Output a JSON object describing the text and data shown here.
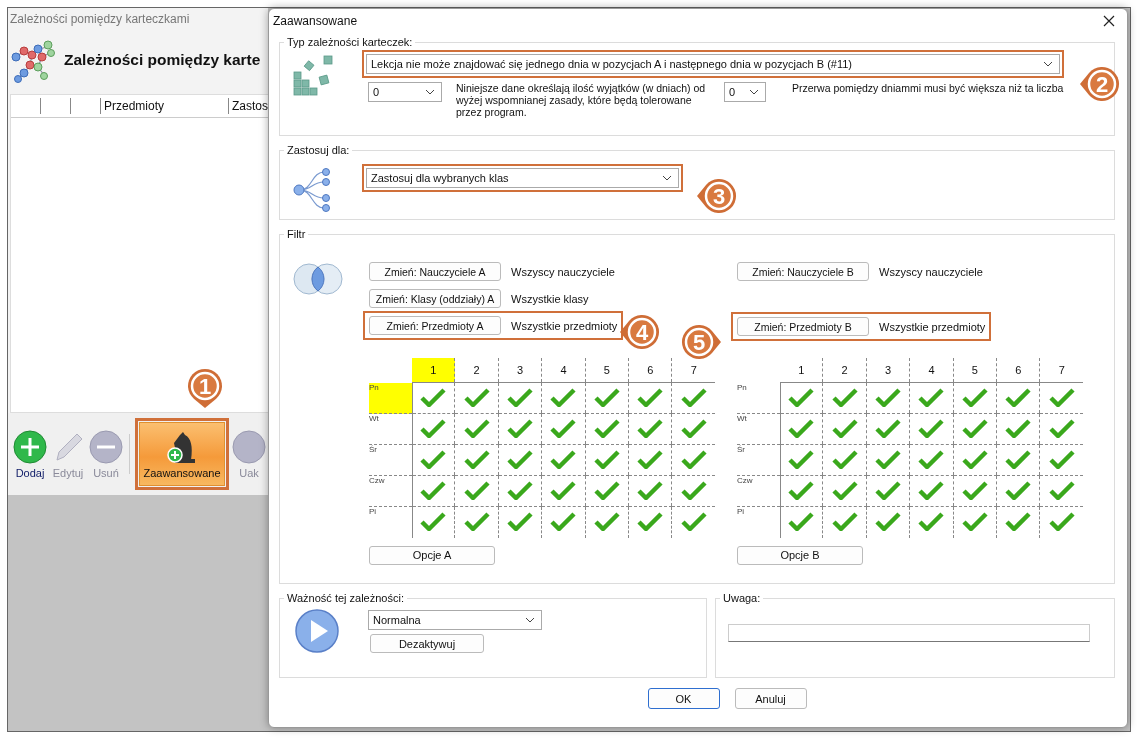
{
  "back_window": {
    "title": "Zależności pomiędzy karteczkami",
    "heading": "Zależności pomiędzy karte",
    "columns": [
      {
        "label": "Przedmioty"
      },
      {
        "label": "Zastos"
      }
    ],
    "toolbar": [
      {
        "label": "Dodaj",
        "kind": "add",
        "disabled": false,
        "highlighted": false
      },
      {
        "label": "Edytuj",
        "kind": "edit",
        "disabled": true,
        "highlighted": false
      },
      {
        "label": "Usuń",
        "kind": "remove",
        "disabled": true,
        "highlighted": false
      },
      {
        "label": "Zaawansowane",
        "kind": "advanced",
        "disabled": false,
        "highlighted": true
      },
      {
        "label": "Uak",
        "kind": "other",
        "disabled": true,
        "highlighted": false
      }
    ]
  },
  "dialog": {
    "title": "Zaawansowane",
    "type_group": {
      "legend": "Typ zależności karteczek:",
      "rule": {
        "value": "Lekcja nie może znajdować się jednego dnia w pozycjach A i następnego dnia w pozycjach B (#11)",
        "highlighted": true
      },
      "exceptions": {
        "value": "0"
      },
      "exceptions_note": "Niniejsze dane określają ilość wyjątków (w dniach) od wyżej wspomnianej zasady, które będą tolerowane przez program.",
      "gap": {
        "value": "0"
      },
      "gap_note": "Przerwa pomiędzy dniammi musi być większa niż ta liczba"
    },
    "apply_group": {
      "legend": "Zastosuj dla:",
      "scope": {
        "value": "Zastosuj dla wybranych klas",
        "highlighted": true
      }
    },
    "filter_group": {
      "legend": "Filtr",
      "sides": [
        {
          "filters": [
            {
              "button": "Zmień: Nauczyciele A",
              "value": "Wszyscy nauczyciele",
              "highlighted": false
            },
            {
              "button": "Zmień: Klasy (oddziały) A",
              "value": "Wszystkie klasy",
              "highlighted": false
            },
            {
              "button": "Zmień: Przedmioty A",
              "value": "Wszystkie przedmioty",
              "highlighted": true
            }
          ],
          "grid": {
            "columns": [
              {
                "label": "1",
                "highlighted": true
              },
              {
                "label": "2",
                "highlighted": false
              },
              {
                "label": "3",
                "highlighted": false
              },
              {
                "label": "4",
                "highlighted": false
              },
              {
                "label": "5",
                "highlighted": false
              },
              {
                "label": "6",
                "highlighted": false
              },
              {
                "label": "7",
                "highlighted": false
              }
            ],
            "rows": [
              {
                "label": "Pn",
                "highlighted": true,
                "checked": [
                  true,
                  true,
                  true,
                  true,
                  true,
                  true,
                  true
                ]
              },
              {
                "label": "Wt",
                "highlighted": false,
                "checked": [
                  true,
                  true,
                  true,
                  true,
                  true,
                  true,
                  true
                ]
              },
              {
                "label": "Śr",
                "highlighted": false,
                "checked": [
                  true,
                  true,
                  true,
                  true,
                  true,
                  true,
                  true
                ]
              },
              {
                "label": "Czw",
                "highlighted": false,
                "checked": [
                  true,
                  true,
                  true,
                  true,
                  true,
                  true,
                  true
                ]
              },
              {
                "label": "Pi",
                "highlighted": false,
                "checked": [
                  true,
                  true,
                  true,
                  true,
                  true,
                  true,
                  true
                ]
              }
            ]
          },
          "options_button": "Opcje A"
        },
        {
          "filters": [
            {
              "button": "Zmień: Nauczyciele B",
              "value": "Wszyscy nauczyciele",
              "highlighted": false
            },
            {
              "button": "Zmień: Przedmioty B",
              "value": "Wszystkie przedmioty",
              "highlighted": true
            }
          ],
          "grid": {
            "columns": [
              {
                "label": "1",
                "highlighted": false
              },
              {
                "label": "2",
                "highlighted": false
              },
              {
                "label": "3",
                "highlighted": false
              },
              {
                "label": "4",
                "highlighted": false
              },
              {
                "label": "5",
                "highlighted": false
              },
              {
                "label": "6",
                "highlighted": false
              },
              {
                "label": "7",
                "highlighted": false
              }
            ],
            "rows": [
              {
                "label": "Pn",
                "highlighted": false,
                "checked": [
                  true,
                  true,
                  true,
                  true,
                  true,
                  true,
                  true
                ]
              },
              {
                "label": "Wt",
                "highlighted": false,
                "checked": [
                  true,
                  true,
                  true,
                  true,
                  true,
                  true,
                  true
                ]
              },
              {
                "label": "Śr",
                "highlighted": false,
                "checked": [
                  true,
                  true,
                  true,
                  true,
                  true,
                  true,
                  true
                ]
              },
              {
                "label": "Czw",
                "highlighted": false,
                "checked": [
                  true,
                  true,
                  true,
                  true,
                  true,
                  true,
                  true
                ]
              },
              {
                "label": "Pi",
                "highlighted": false,
                "checked": [
                  true,
                  true,
                  true,
                  true,
                  true,
                  true,
                  true
                ]
              }
            ]
          },
          "options_button": "Opcje B"
        }
      ]
    },
    "priority_group": {
      "legend": "Ważność tej zależności:",
      "value": "Normalna",
      "deactivate_button": "Dezaktywuj"
    },
    "note_group": {
      "legend": "Uwaga:"
    },
    "buttons": [
      {
        "label": "OK",
        "default": true
      },
      {
        "label": "Anuluj",
        "default": false
      }
    ]
  },
  "callouts": [
    {
      "number": "1"
    },
    {
      "number": "2"
    },
    {
      "number": "3"
    },
    {
      "number": "4"
    },
    {
      "number": "5"
    }
  ]
}
